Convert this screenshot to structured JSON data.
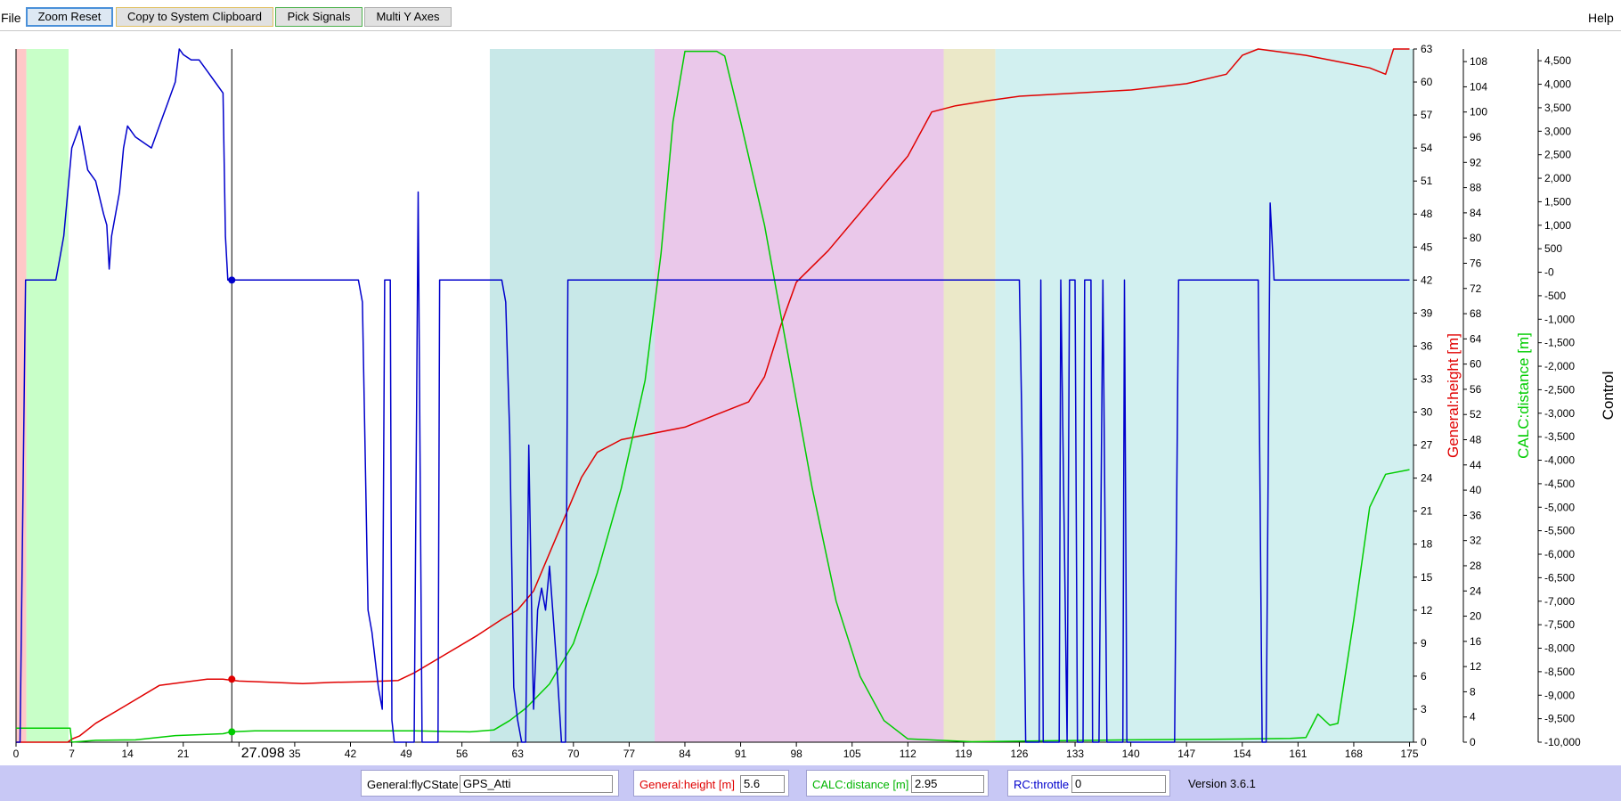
{
  "menu": {
    "file": "File",
    "help": "Help"
  },
  "toolbar": {
    "zoom_reset": "Zoom Reset",
    "copy_clipboard": "Copy to System Clipboard",
    "pick_signals": "Pick Signals",
    "multi_y_axes": "Multi Y Axes"
  },
  "chart_data": {
    "type": "line",
    "x_ticks": [
      "0",
      "7",
      "14",
      "21",
      "28",
      "35",
      "42",
      "49",
      "56",
      "63",
      "70",
      "77",
      "84",
      "91",
      "98",
      "105",
      "112",
      "119",
      "126",
      "133",
      "140",
      "147",
      "154",
      "161",
      "168",
      "175"
    ],
    "xlim": [
      0,
      175.5
    ],
    "cursor_time": "27.098",
    "flight_modes": [
      {
        "from": 0,
        "to": 1.3,
        "color": "#ffc8c8"
      },
      {
        "from": 1.3,
        "to": 6.6,
        "color": "#c8ffc8"
      },
      {
        "from": 59.5,
        "to": 80.2,
        "color": "#c8e8e8"
      },
      {
        "from": 80.2,
        "to": 116.5,
        "color": "#eac8ea"
      },
      {
        "from": 116.5,
        "to": 123,
        "color": "#ebe8c8"
      },
      {
        "from": 123,
        "to": 175.5,
        "color": "#d2f0f0"
      }
    ],
    "axes": [
      {
        "id": "control",
        "title": "Control",
        "color": "#000000",
        "min": 0,
        "max": 63,
        "ticks": [
          "0",
          "3",
          "6",
          "9",
          "12",
          "15",
          "18",
          "21",
          "24",
          "27",
          "30",
          "33",
          "36",
          "39",
          "42",
          "45",
          "48",
          "51",
          "54",
          "57",
          "60",
          "63"
        ]
      },
      {
        "id": "height",
        "title": "General:height [m]",
        "color": "#e00000",
        "min": 0,
        "max": 110,
        "ticks": [
          "0",
          "4",
          "8",
          "12",
          "16",
          "20",
          "24",
          "28",
          "32",
          "36",
          "40",
          "44",
          "48",
          "52",
          "56",
          "60",
          "64",
          "68",
          "72",
          "76",
          "80",
          "84",
          "88",
          "92",
          "96",
          "100",
          "104",
          "108"
        ]
      },
      {
        "id": "distance",
        "title": "CALC:distance [m]",
        "color": "#00cc00",
        "min": -10000,
        "max": 4750,
        "ticks": [
          "-10,000",
          "-9,500",
          "-9,000",
          "-8,500",
          "-8,000",
          "-7,500",
          "-7,000",
          "-6,500",
          "-6,000",
          "-5,500",
          "-5,000",
          "-4,500",
          "-4,000",
          "-3,500",
          "-3,000",
          "-2,500",
          "-2,000",
          "-1,500",
          "-1,000",
          "-500",
          "-0",
          "500",
          "1,000",
          "1,500",
          "2,000",
          "2,500",
          "3,000",
          "3,500",
          "4,000",
          "4,500"
        ]
      }
    ],
    "series": [
      {
        "name": "General:height [m]",
        "axis": "height",
        "color": "#e00000",
        "points": [
          [
            0,
            0
          ],
          [
            6.5,
            0
          ],
          [
            7,
            0.5
          ],
          [
            8,
            1
          ],
          [
            10,
            3
          ],
          [
            14,
            6
          ],
          [
            18,
            9
          ],
          [
            21,
            9.5
          ],
          [
            24,
            10
          ],
          [
            26,
            10
          ],
          [
            28,
            9.7
          ],
          [
            32,
            9.5
          ],
          [
            36,
            9.3
          ],
          [
            40,
            9.5
          ],
          [
            44,
            9.6
          ],
          [
            48,
            9.8
          ],
          [
            50,
            11
          ],
          [
            54,
            14
          ],
          [
            58,
            17
          ],
          [
            61,
            19.5
          ],
          [
            63,
            21
          ],
          [
            65,
            24
          ],
          [
            67,
            30
          ],
          [
            69,
            36
          ],
          [
            71,
            42
          ],
          [
            73,
            46
          ],
          [
            76,
            48
          ],
          [
            80,
            49
          ],
          [
            84,
            50
          ],
          [
            88,
            52
          ],
          [
            92,
            54
          ],
          [
            94,
            58
          ],
          [
            96,
            66
          ],
          [
            98,
            73
          ],
          [
            102,
            78
          ],
          [
            108,
            87
          ],
          [
            112,
            93
          ],
          [
            115,
            100
          ],
          [
            118,
            101
          ],
          [
            122,
            101.8
          ],
          [
            126,
            102.5
          ],
          [
            133,
            103
          ],
          [
            140,
            103.5
          ],
          [
            147,
            104.5
          ],
          [
            152,
            106
          ],
          [
            154,
            109
          ],
          [
            156,
            110
          ],
          [
            162,
            109
          ],
          [
            166,
            108
          ],
          [
            170,
            107
          ],
          [
            172,
            106
          ],
          [
            173,
            110
          ],
          [
            175,
            110
          ]
        ]
      },
      {
        "name": "CALC:distance [m]",
        "axis": "distance",
        "color": "#00cc00",
        "points": [
          [
            0,
            -9700
          ],
          [
            6.8,
            -9700
          ],
          [
            7,
            -10000
          ],
          [
            10,
            -9960
          ],
          [
            15,
            -9950
          ],
          [
            20,
            -9860
          ],
          [
            26,
            -9820
          ],
          [
            27,
            -9780
          ],
          [
            30,
            -9760
          ],
          [
            40,
            -9760
          ],
          [
            50,
            -9760
          ],
          [
            57,
            -9780
          ],
          [
            60,
            -9740
          ],
          [
            62,
            -9540
          ],
          [
            64,
            -9280
          ],
          [
            67,
            -8760
          ],
          [
            70,
            -7900
          ],
          [
            73,
            -6400
          ],
          [
            76,
            -4600
          ],
          [
            79,
            -2300
          ],
          [
            81,
            400
          ],
          [
            82.5,
            3200
          ],
          [
            84,
            4700
          ],
          [
            88,
            4700
          ],
          [
            89,
            4600
          ],
          [
            91,
            3200
          ],
          [
            94,
            1000
          ],
          [
            97,
            -1800
          ],
          [
            100,
            -4600
          ],
          [
            103,
            -7000
          ],
          [
            106,
            -8600
          ],
          [
            109,
            -9540
          ],
          [
            112,
            -9930
          ],
          [
            120,
            -9990
          ],
          [
            130,
            -9970
          ],
          [
            140,
            -9950
          ],
          [
            150,
            -9940
          ],
          [
            160,
            -9920
          ],
          [
            162,
            -9900
          ],
          [
            163.5,
            -9400
          ],
          [
            165,
            -9640
          ],
          [
            166,
            -9600
          ],
          [
            168,
            -7400
          ],
          [
            170,
            -5000
          ],
          [
            172,
            -4300
          ],
          [
            175,
            -4200
          ]
        ]
      },
      {
        "name": "RC:throttle",
        "axis": "control",
        "color": "#0000cc",
        "points": [
          [
            0,
            0
          ],
          [
            0.5,
            0
          ],
          [
            1.2,
            42
          ],
          [
            5,
            42
          ],
          [
            5.5,
            44
          ],
          [
            6,
            46
          ],
          [
            6.5,
            50
          ],
          [
            7,
            54
          ],
          [
            8,
            56
          ],
          [
            9,
            52
          ],
          [
            10,
            51
          ],
          [
            11,
            48
          ],
          [
            11.4,
            47
          ],
          [
            11.7,
            43
          ],
          [
            12,
            46
          ],
          [
            13,
            50
          ],
          [
            13.5,
            54
          ],
          [
            14,
            56
          ],
          [
            15,
            55
          ],
          [
            17,
            54
          ],
          [
            18,
            56
          ],
          [
            19,
            58
          ],
          [
            20,
            60
          ],
          [
            20.5,
            63
          ],
          [
            21,
            62.5
          ],
          [
            22,
            62
          ],
          [
            23,
            62
          ],
          [
            24,
            61
          ],
          [
            25,
            60
          ],
          [
            26,
            59
          ],
          [
            26.3,
            46
          ],
          [
            26.6,
            42
          ],
          [
            27,
            42
          ],
          [
            28,
            42
          ],
          [
            43,
            42
          ],
          [
            43.5,
            40
          ],
          [
            44.2,
            12
          ],
          [
            44.7,
            10
          ],
          [
            45.5,
            5
          ],
          [
            46,
            3
          ],
          [
            46.3,
            42
          ],
          [
            47,
            42
          ],
          [
            47.2,
            2
          ],
          [
            47.5,
            0
          ],
          [
            50,
            0
          ],
          [
            50.5,
            50
          ],
          [
            51,
            0
          ],
          [
            53,
            0
          ],
          [
            53.2,
            42
          ],
          [
            57,
            42
          ],
          [
            58,
            42
          ],
          [
            61,
            42
          ],
          [
            61.5,
            40
          ],
          [
            62,
            28
          ],
          [
            62.5,
            5
          ],
          [
            63,
            2
          ],
          [
            63.5,
            0
          ],
          [
            64,
            0
          ],
          [
            64.4,
            27
          ],
          [
            64.8,
            10
          ],
          [
            65,
            3
          ],
          [
            65.5,
            12
          ],
          [
            66,
            14
          ],
          [
            66.5,
            12
          ],
          [
            67,
            16
          ],
          [
            68,
            6
          ],
          [
            68.5,
            0
          ],
          [
            69,
            0
          ],
          [
            69.3,
            42
          ],
          [
            71,
            42
          ],
          [
            90,
            42
          ],
          [
            126,
            42
          ],
          [
            126.3,
            30
          ],
          [
            126.8,
            0
          ],
          [
            127,
            0
          ],
          [
            128.5,
            0
          ],
          [
            128.7,
            42
          ],
          [
            129,
            0
          ],
          [
            131,
            0
          ],
          [
            131.2,
            42
          ],
          [
            132,
            0
          ],
          [
            132.3,
            42
          ],
          [
            133,
            42
          ],
          [
            133.3,
            0
          ],
          [
            134,
            0
          ],
          [
            134.2,
            42
          ],
          [
            135,
            42
          ],
          [
            135.2,
            0
          ],
          [
            136,
            0
          ],
          [
            136.5,
            42
          ],
          [
            137,
            0
          ],
          [
            139,
            0
          ],
          [
            139.2,
            42
          ],
          [
            139.5,
            0
          ],
          [
            140,
            0
          ],
          [
            145,
            0
          ],
          [
            145.5,
            0
          ],
          [
            146,
            42
          ],
          [
            147,
            42
          ],
          [
            156,
            42
          ],
          [
            156.5,
            0
          ],
          [
            157,
            0
          ],
          [
            157.5,
            49
          ],
          [
            158,
            42
          ],
          [
            175,
            42
          ]
        ]
      }
    ],
    "cursor_dots": [
      {
        "axis": "control",
        "x": 27.1,
        "y": 42
      },
      {
        "axis": "height",
        "x": 27.1,
        "y": 10
      },
      {
        "axis": "distance",
        "x": 27.1,
        "y": -9780
      }
    ]
  },
  "status": {
    "flyc_label": "General:flyCState",
    "flyc_value": "GPS_Atti",
    "height_label": "General:height [m]",
    "height_value": "5.6",
    "distance_label": "CALC:distance [m]",
    "distance_value": "2.95",
    "throttle_label": "RC:throttle",
    "throttle_value": "0",
    "version": "Version 3.6.1"
  }
}
